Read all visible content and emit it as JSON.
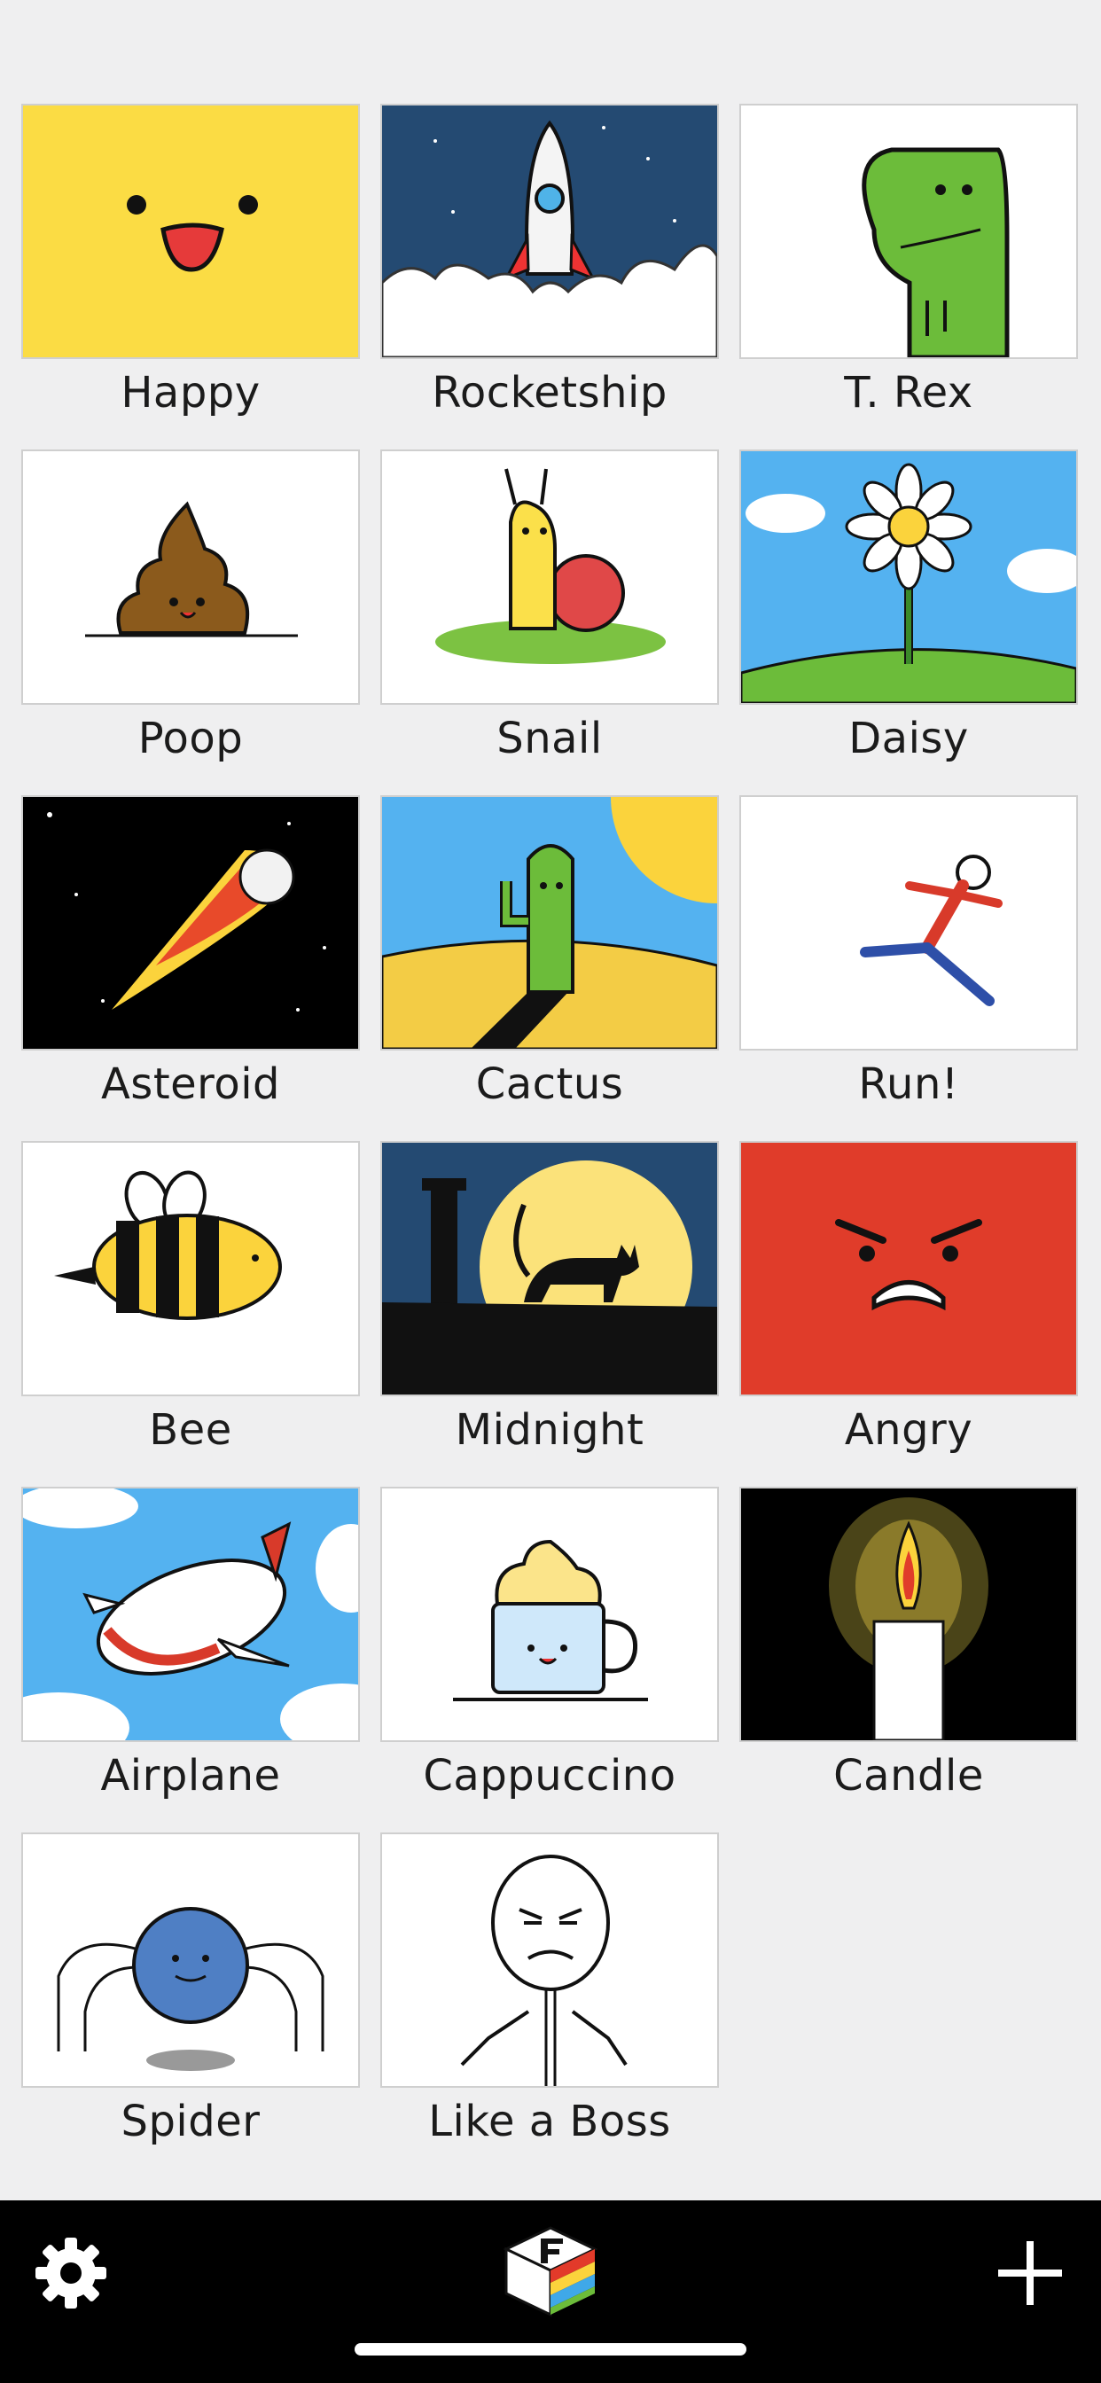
{
  "drawings": [
    {
      "title": "Happy",
      "icon": "happy-face-icon"
    },
    {
      "title": "Rocketship",
      "icon": "rocket-icon"
    },
    {
      "title": "T. Rex",
      "icon": "dinosaur-icon"
    },
    {
      "title": "Poop",
      "icon": "poop-icon"
    },
    {
      "title": "Snail",
      "icon": "snail-icon"
    },
    {
      "title": "Daisy",
      "icon": "flower-icon"
    },
    {
      "title": "Asteroid",
      "icon": "asteroid-icon"
    },
    {
      "title": "Cactus",
      "icon": "cactus-icon"
    },
    {
      "title": "Run!",
      "icon": "runner-icon"
    },
    {
      "title": "Bee",
      "icon": "bee-icon"
    },
    {
      "title": "Midnight",
      "icon": "cat-moon-icon"
    },
    {
      "title": "Angry",
      "icon": "angry-face-icon"
    },
    {
      "title": "Airplane",
      "icon": "airplane-icon"
    },
    {
      "title": "Cappuccino",
      "icon": "coffee-cup-icon"
    },
    {
      "title": "Candle",
      "icon": "candle-icon"
    },
    {
      "title": "Spider",
      "icon": "spider-icon"
    },
    {
      "title": "Like a Boss",
      "icon": "rage-face-icon"
    }
  ],
  "toolbar": {
    "settings_icon": "gear-icon",
    "app_logo_icon": "flipbook-logo-icon",
    "new_icon": "plus-icon"
  },
  "colors": {
    "background": "#efeff0",
    "tabbar": "#000000",
    "label_text": "#1b1b1b"
  }
}
